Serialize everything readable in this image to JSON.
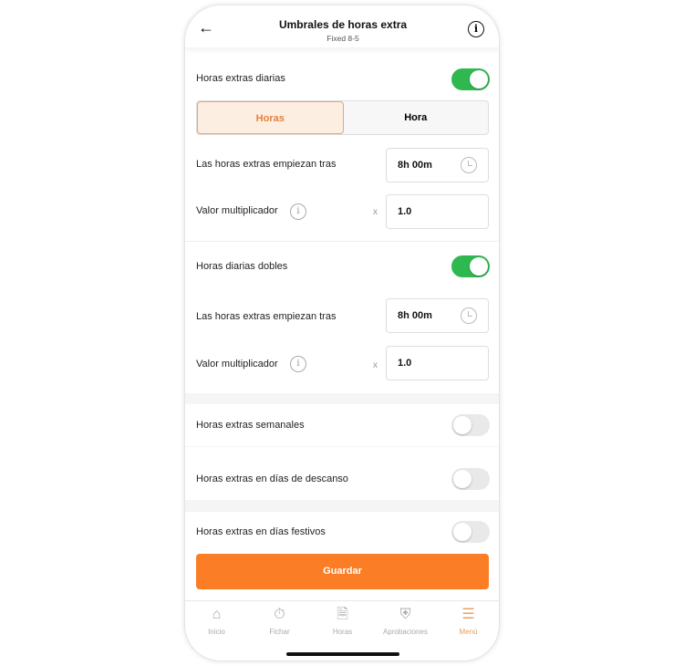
{
  "header": {
    "title": "Umbrales de horas extra",
    "subtitle": "Fixed 8-5",
    "back_icon": "arrow-left-icon",
    "info_icon": "info-icon"
  },
  "daily": {
    "label": "Horas extras diarias",
    "enabled": true,
    "segments": [
      "Horas",
      "Hora"
    ],
    "selected_segment": "Horas",
    "start_label": "Las horas extras empiezan tras",
    "start_value": "8h 00m",
    "multiplier_label": "Valor multiplicador",
    "multiplier_prefix": "x",
    "multiplier_value": "1.0"
  },
  "double": {
    "label": "Horas diarias dobles",
    "enabled": true,
    "start_label": "Las horas extras empiezan tras",
    "start_value": "8h 00m",
    "multiplier_label": "Valor multiplicador",
    "multiplier_prefix": "x",
    "multiplier_value": "1.0"
  },
  "weekly": {
    "label": "Horas extras semanales",
    "enabled": false
  },
  "restdays": {
    "label": "Horas extras en días de descanso",
    "enabled": false
  },
  "holidays": {
    "label": "Horas extras en días festivos",
    "enabled": false
  },
  "save_label": "Guardar",
  "accent": "#fb7d26",
  "toggle_on": "#2fb84f",
  "nav": [
    {
      "label": "Inicio",
      "icon": "home-icon"
    },
    {
      "label": "Fichar",
      "icon": "stopwatch-icon"
    },
    {
      "label": "Horas",
      "icon": "timesheet-icon"
    },
    {
      "label": "Aprobaciones",
      "icon": "shield-check-icon"
    },
    {
      "label": "Menú",
      "icon": "menu-icon",
      "active": true
    }
  ]
}
